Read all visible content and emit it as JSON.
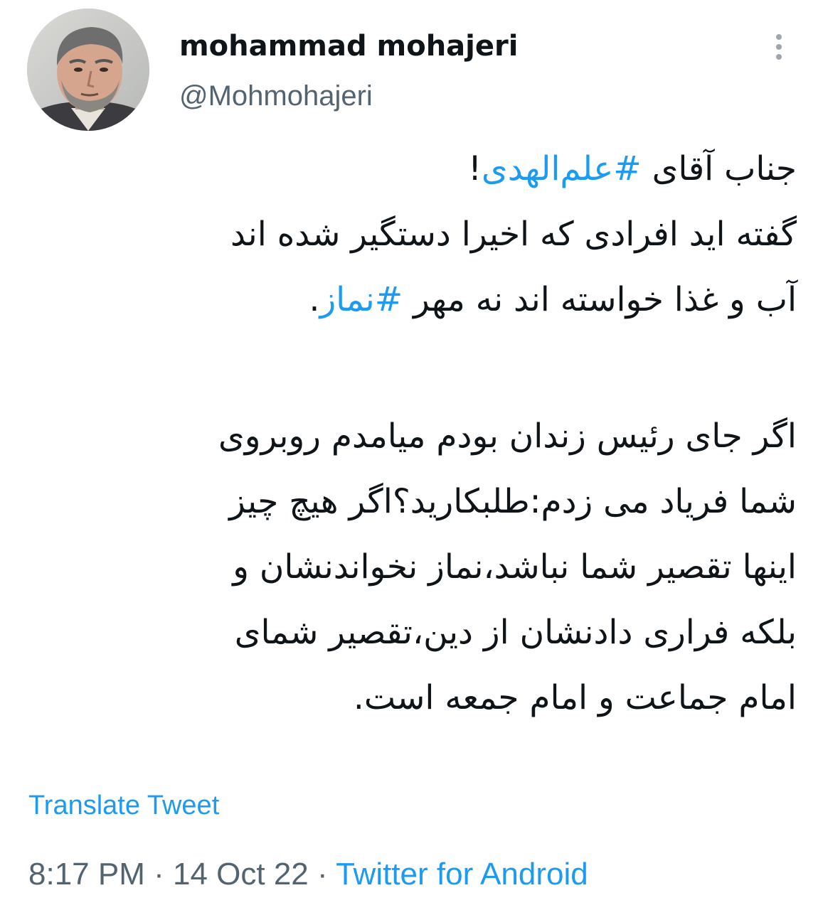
{
  "tweet": {
    "author": {
      "display_name": "mohammad mohajeri",
      "handle": "@Mohmohajeri"
    },
    "text_lines": [
      {
        "before": "جناب آقای ",
        "hashtag": "#علم‌الهدی",
        "after": "!"
      },
      {
        "before": "گفته اید افرادی که اخیرا دستگیر شده اند",
        "hashtag": "",
        "after": ""
      },
      {
        "before": "آب و غذا خواسته اند نه مهر ",
        "hashtag": "#نماز",
        "after": "."
      },
      {
        "before": "اگر جای رئیس زندان بودم میامدم روبروی",
        "hashtag": "",
        "after": ""
      },
      {
        "before": "شما فریاد می زدم:طلبکارید؟اگر هیچ چیز",
        "hashtag": "",
        "after": ""
      },
      {
        "before": "اینها تقصیر شما نباشد،نماز نخواندنشان و",
        "hashtag": "",
        "after": ""
      },
      {
        "before": "بلکه فراری دادنشان از دین،تقصیر شمای",
        "hashtag": "",
        "after": ""
      },
      {
        "before": "امام جماعت و امام جمعه است.",
        "hashtag": "",
        "after": ""
      }
    ],
    "translate_label": "Translate Tweet",
    "time": "8:17 PM",
    "separator": "·",
    "date": "14 Oct 22",
    "source": "Twitter for Android"
  },
  "icons": {
    "more": "more-vertical-icon"
  },
  "colors": {
    "link": "#1d9bf0",
    "secondary_text": "#536471",
    "primary_text": "#0f1419"
  }
}
